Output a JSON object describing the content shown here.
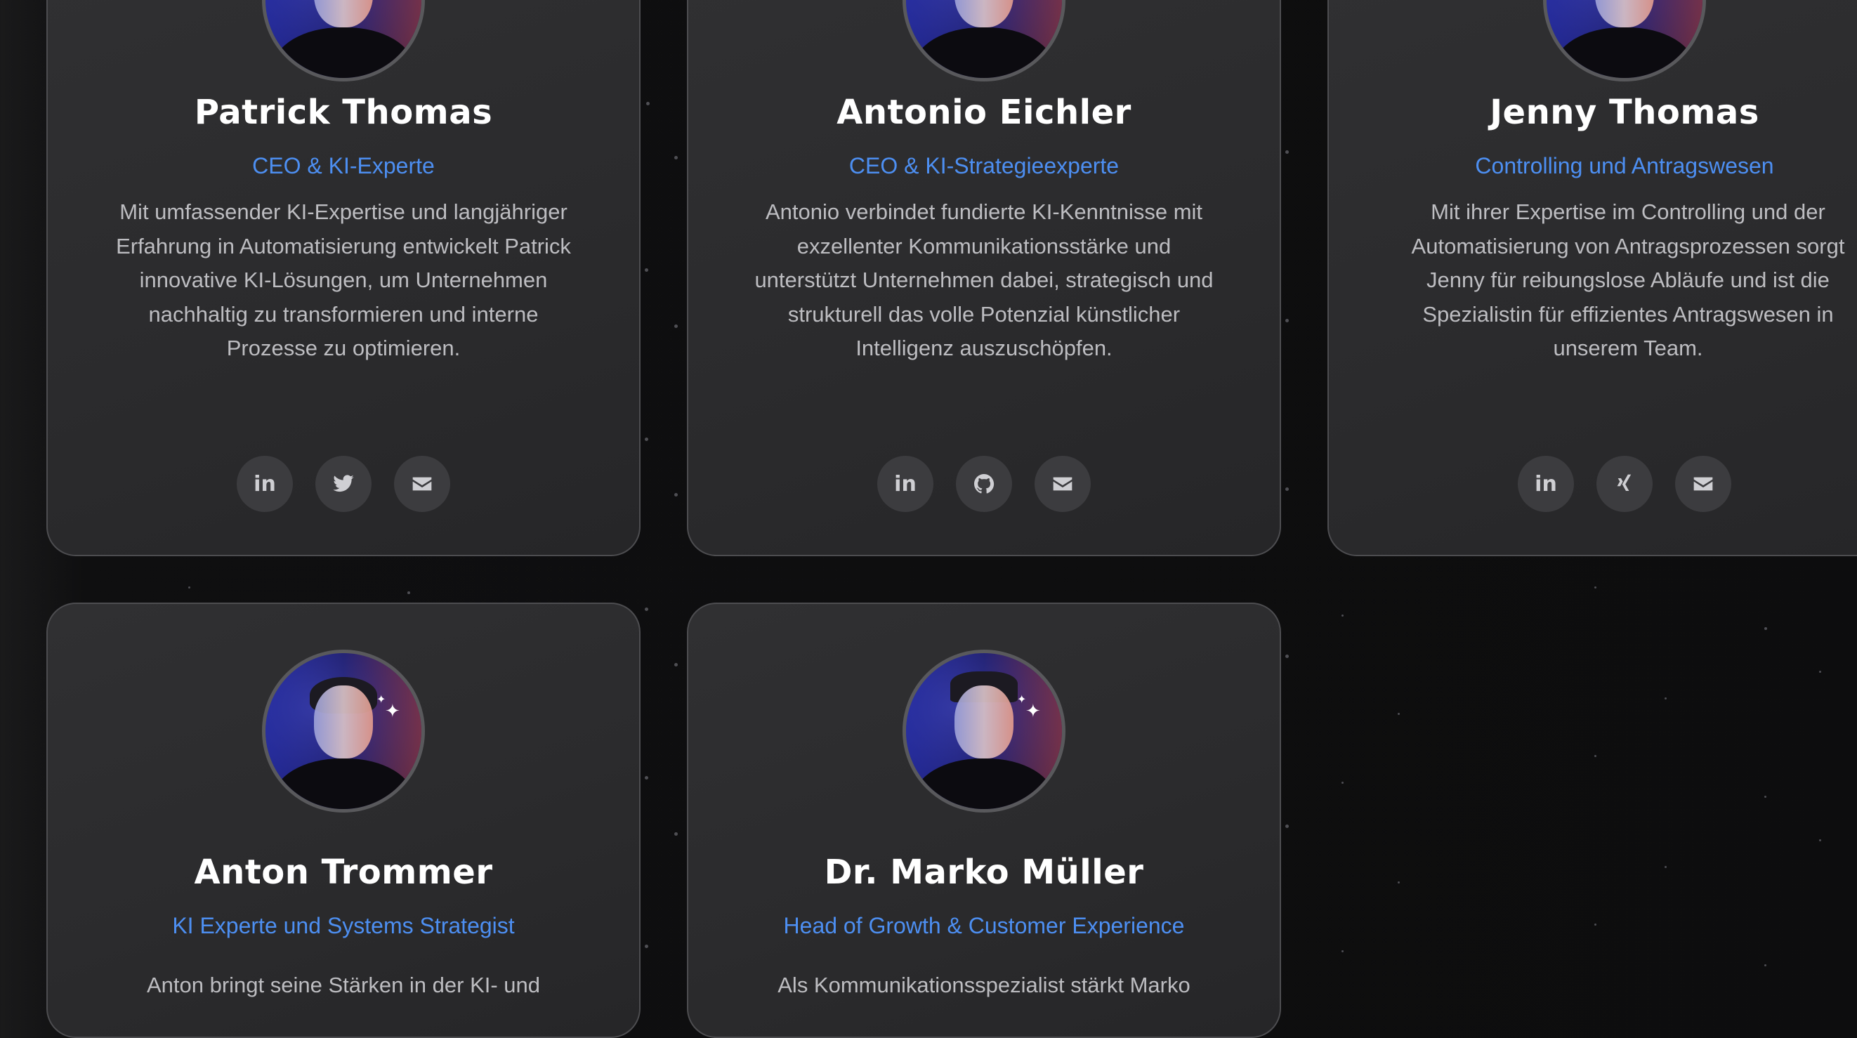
{
  "team": [
    {
      "name": "Patrick Thomas",
      "role": "CEO & KI-Experte",
      "bio_lines": [
        "Mit umfassender KI-Expertise und langjähriger",
        "Erfahrung in Automatisierung entwickelt Patrick",
        "innovative KI-Lösungen, um Unternehmen",
        "nachhaltig zu transformieren und interne",
        "Prozesse zu optimieren."
      ],
      "socials": [
        "linkedin-icon",
        "twitter-icon",
        "email-icon"
      ]
    },
    {
      "name": "Antonio Eichler",
      "role": "CEO & KI-Strategieexperte",
      "bio_lines": [
        "Antonio verbindet fundierte KI-Kenntnisse mit",
        "exzellenter Kommunikationsstärke und",
        "unterstützt Unternehmen dabei, strategisch und",
        "strukturell das volle Potenzial künstlicher",
        "Intelligenz auszuschöpfen."
      ],
      "socials": [
        "linkedin-icon",
        "github-icon",
        "email-icon"
      ]
    },
    {
      "name": "Jenny Thomas",
      "role": "Controlling und Antragswesen",
      "bio_lines": [
        "Mit ihrer Expertise im Controlling und der",
        "Automatisierung von Antragsprozessen sorgt",
        "Jenny für reibungslose Abläufe und ist die",
        "Spezialistin für effizientes Antragswesen in",
        "unserem Team."
      ],
      "socials": [
        "linkedin-icon",
        "xing-icon",
        "email-icon"
      ]
    },
    {
      "name": "Anton Trommer",
      "role": "KI Experte und Systems Strategist",
      "bio_lines": [
        "Anton bringt seine Stärken in der KI- und"
      ]
    },
    {
      "name": "Dr. Marko Müller",
      "role": "Head of Growth & Customer Experience",
      "bio_lines": [
        "Als Kommunikationsspezialist stärkt Marko"
      ]
    }
  ],
  "colors": {
    "accent": "#4d8ff2",
    "card_bg": "#2c2c2e",
    "text_muted": "#bdbdc1"
  }
}
